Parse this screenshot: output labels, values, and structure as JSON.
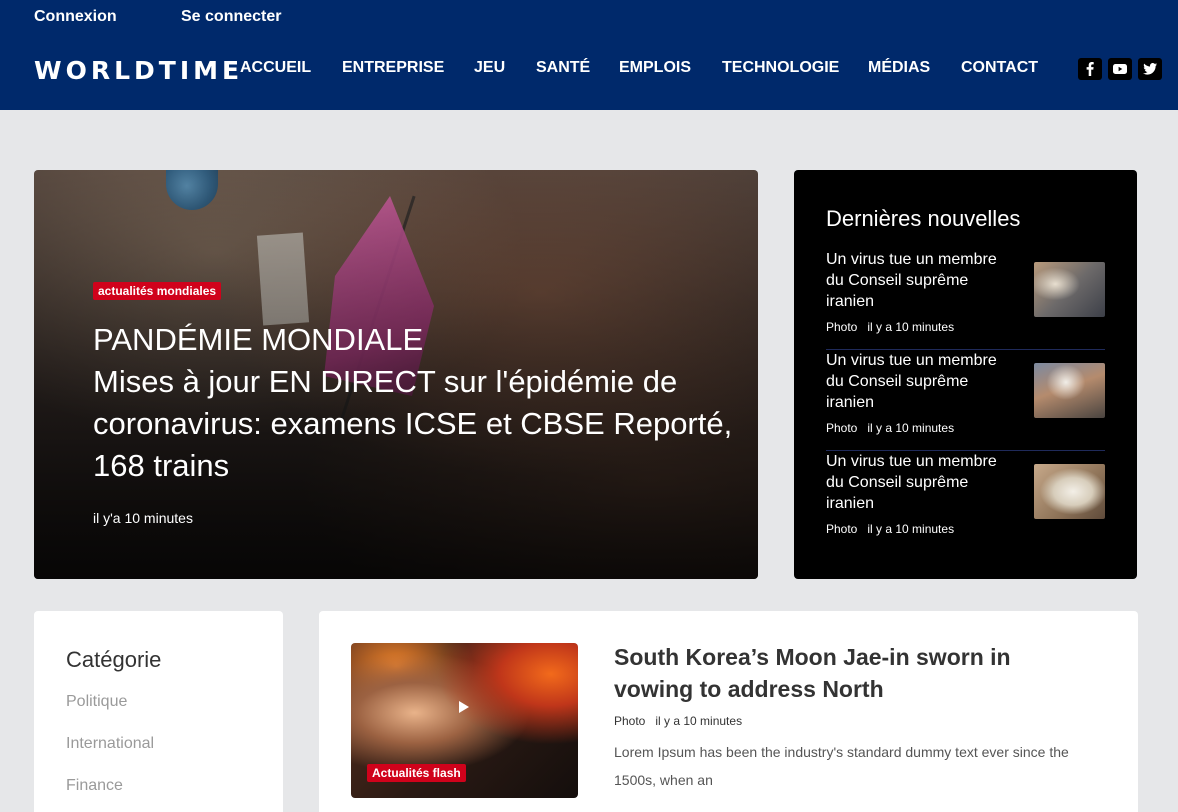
{
  "header": {
    "top_links": [
      "Connexion",
      "Se connecter"
    ],
    "logo": "WORLDTIME",
    "nav": [
      "ACCUEIL",
      "ENTREPRISE",
      "JEU",
      "SANTÉ",
      "EMPLOIS",
      "TECHNOLOGIE",
      "MÉDIAS",
      "CONTACT"
    ],
    "social_icons": [
      "facebook-icon",
      "youtube-icon",
      "twitter-icon"
    ],
    "colors": {
      "background": "#00296b",
      "text": "#ffffff"
    }
  },
  "hero": {
    "badge": "actualités mondiales",
    "title": "PANDÉMIE MONDIALE",
    "subtitle": "Mises à jour EN DIRECT sur l'épidémie de coronavirus: examens ICSE et CBSE Reporté, 168 trains",
    "time": "il y'a 10 minutes"
  },
  "latest": {
    "title": "Dernières nouvelles",
    "items": [
      {
        "headline": "Un virus tue un membre du Conseil suprême iranien",
        "tag": "Photo",
        "time": "il y a 10 minutes"
      },
      {
        "headline": "Un virus tue un membre du Conseil suprême iranien",
        "tag": "Photo",
        "time": "il y a 10 minutes"
      },
      {
        "headline": "Un virus tue un membre du Conseil suprême iranien",
        "tag": "Photo",
        "time": "il y a 10 minutes"
      }
    ]
  },
  "category": {
    "title": "Catégorie",
    "items": [
      "Politique",
      "International",
      "Finance"
    ]
  },
  "article": {
    "badge": "Actualités flash",
    "title": "South Korea’s Moon Jae-in sworn in vowing to address North",
    "tag": "Photo",
    "time": "il y a 10 minutes",
    "body": "Lorem Ipsum has been the industry's standard dummy text ever since the 1500s, when an"
  },
  "colors": {
    "accent": "#d0021b",
    "page_bg": "#e6e7e9",
    "news_panel": "#000000"
  }
}
